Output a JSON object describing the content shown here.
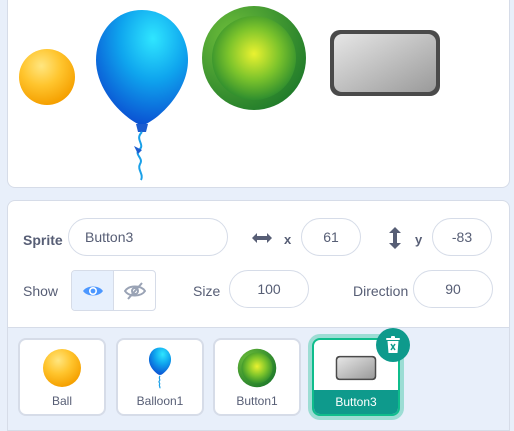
{
  "stage": {
    "sprites": [
      "ball",
      "balloon",
      "green-button",
      "gray-button"
    ]
  },
  "sprite_info": {
    "sprite_label": "Sprite",
    "sprite_name": "Button3",
    "x_label": "x",
    "x_value": "61",
    "y_label": "y",
    "y_value": "-83",
    "show_label": "Show",
    "size_label": "Size",
    "size_value": "100",
    "direction_label": "Direction",
    "direction_value": "90"
  },
  "sprite_list": {
    "items": [
      {
        "name": "Ball",
        "icon": "ball-icon"
      },
      {
        "name": "Balloon1",
        "icon": "balloon-icon"
      },
      {
        "name": "Button1",
        "icon": "green-button-icon"
      },
      {
        "name": "Button3",
        "icon": "gray-button-icon",
        "selected": true
      }
    ]
  },
  "colors": {
    "accent": "#0e9a8c",
    "selection_glow": "#0fbd8c",
    "show_active": "#4c97ff"
  }
}
